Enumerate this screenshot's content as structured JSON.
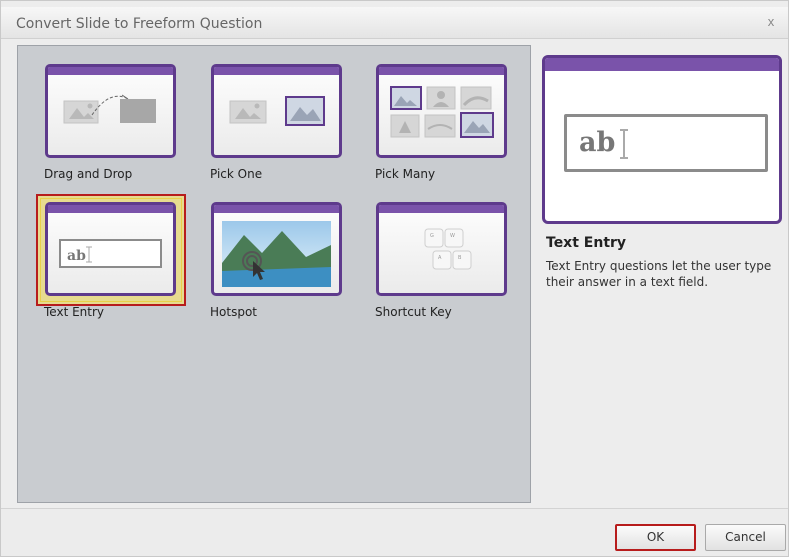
{
  "dialog": {
    "title": "Convert Slide to Freeform Question",
    "close_label": "x"
  },
  "question_types": [
    {
      "label": "Drag and Drop",
      "icon": "drag-and-drop-icon"
    },
    {
      "label": "Pick One",
      "icon": "pick-one-icon"
    },
    {
      "label": "Pick Many",
      "icon": "pick-many-icon"
    },
    {
      "label": "Text Entry",
      "icon": "text-entry-icon",
      "selected": true
    },
    {
      "label": "Hotspot",
      "icon": "hotspot-icon"
    },
    {
      "label": "Shortcut Key",
      "icon": "shortcut-key-icon"
    }
  ],
  "preview": {
    "sample_text": "ab",
    "title": "Text Entry",
    "description": "Text Entry questions let the user type their answer in a text field."
  },
  "buttons": {
    "ok": "OK",
    "cancel": "Cancel"
  },
  "colors": {
    "accent_purple": "#5e3a8c",
    "selection_red": "#b71c1c",
    "selection_yellow": "#ffe85a"
  }
}
